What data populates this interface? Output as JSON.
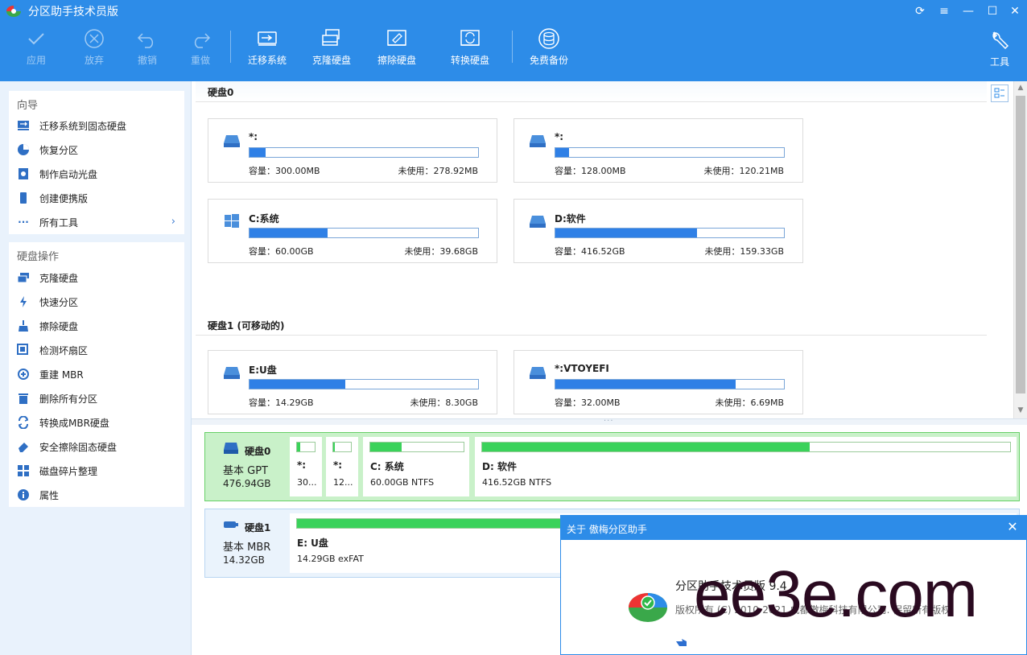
{
  "app": {
    "title": "分区助手技术员版"
  },
  "toolbar": {
    "apply": "应用",
    "discard": "放弃",
    "undo": "撤销",
    "redo": "重做",
    "migrate": "迁移系统",
    "clone": "克隆硬盘",
    "wipe": "擦除硬盘",
    "convert": "转换硬盘",
    "backup": "免费备份",
    "tools": "工具"
  },
  "sidebar": {
    "wizard_title": "向导",
    "wizard_items": [
      "迁移系统到固态硬盘",
      "恢复分区",
      "制作启动光盘",
      "创建便携版",
      "所有工具"
    ],
    "disk_ops_title": "硬盘操作",
    "disk_ops_items": [
      "克隆硬盘",
      "快速分区",
      "擦除硬盘",
      "检测坏扇区",
      "重建 MBR",
      "删除所有分区",
      "转换成MBR硬盘",
      "安全擦除固态硬盘",
      "磁盘碎片整理",
      "属性"
    ]
  },
  "disks": [
    {
      "header": "硬盘0",
      "partitions": [
        {
          "name": "*:",
          "usage": 0.07,
          "capacity": "容量：300.00MB",
          "free": "未使用：278.92MB",
          "icon": "drive-icon"
        },
        {
          "name": "*:",
          "usage": 0.06,
          "capacity": "容量：128.00MB",
          "free": "未使用：120.21MB",
          "icon": "drive-icon"
        },
        {
          "name": "C:系统",
          "usage": 0.34,
          "capacity": "容量：60.00GB",
          "free": "未使用：39.68GB",
          "icon": "windows-icon"
        },
        {
          "name": "D:软件",
          "usage": 0.62,
          "capacity": "容量：416.52GB",
          "free": "未使用：159.33GB",
          "icon": "drive-icon"
        }
      ]
    },
    {
      "header": "硬盘1 (可移动的)",
      "partitions": [
        {
          "name": "E:U盘",
          "usage": 0.42,
          "capacity": "容量：14.29GB",
          "free": "未使用：8.30GB",
          "icon": "drive-icon"
        },
        {
          "name": "*:VTOYEFI",
          "usage": 0.79,
          "capacity": "容量：32.00MB",
          "free": "未使用：6.69MB",
          "icon": "drive-icon"
        }
      ]
    }
  ],
  "disk_map": [
    {
      "name": "硬盘0",
      "type": "基本 GPT",
      "size": "476.94GB",
      "blocks": [
        {
          "name": "*:",
          "info": "30...",
          "usage": 0.2
        },
        {
          "name": "*:",
          "info": "12...",
          "usage": 0.1
        },
        {
          "name": "C: 系统",
          "info": "60.00GB NTFS",
          "usage": 0.34
        },
        {
          "name": "D: 软件",
          "info": "416.52GB NTFS",
          "usage": 0.62
        }
      ]
    },
    {
      "name": "硬盘1",
      "type": "基本 MBR",
      "size": "14.32GB",
      "blocks": [
        {
          "name": "E: U盘",
          "info": "14.29GB exFAT",
          "usage": 0.42
        }
      ]
    }
  ],
  "about": {
    "title": "关于 傲梅分区助手",
    "product": "分区助手技术员版 9.4",
    "copyright": "版权所有 (C) 2010-2021 成都傲梅科技有限公司. 保留所有版权."
  },
  "watermark": "ee3e.com",
  "colors": {
    "accent": "#2d8ce8",
    "usage_bar": "#2f80e6",
    "map_bar": "#3ad25a",
    "selected_row": "#c9f1c9"
  }
}
